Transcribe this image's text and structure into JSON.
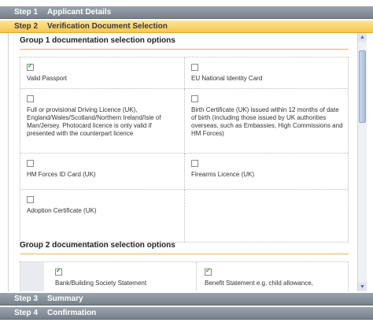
{
  "steps": [
    {
      "num": "Step 1",
      "label": "Applicant Details"
    },
    {
      "num": "Step 2",
      "label": "Verification Document Selection"
    },
    {
      "num": "Step 3",
      "label": "Summary"
    },
    {
      "num": "Step 4",
      "label": "Confirmation"
    }
  ],
  "group1": {
    "title": "Group 1 documentation selection options",
    "items": [
      {
        "label": "Valid Passport",
        "checked": true
      },
      {
        "label": "EU National Identity Card",
        "checked": false
      },
      {
        "label": "Full or provisional Driving Licence (UK), England/Wales/Scotland/Northern Ireland/Isle of Man/Jersey. Photocard licence is only valid if presented with the counterpart licence",
        "checked": false
      },
      {
        "label": "Birth Certificate (UK) issued within 12 months of date of birth (including those issued by UK authorities overseas, such as Embassies, High Commissions and HM Forces)",
        "checked": false
      },
      {
        "label": "HM Forces ID Card (UK)",
        "checked": false
      },
      {
        "label": "Firearms Licence (UK)",
        "checked": false
      },
      {
        "label": "Adoption Certificate (UK)",
        "checked": false
      }
    ]
  },
  "group2": {
    "title": "Group 2 documentation selection options",
    "items": [
      {
        "label": "Bank/Building Society Statement",
        "checked": true
      },
      {
        "label": "Benefit Statement e.g. child allowance,",
        "checked": true
      }
    ]
  }
}
